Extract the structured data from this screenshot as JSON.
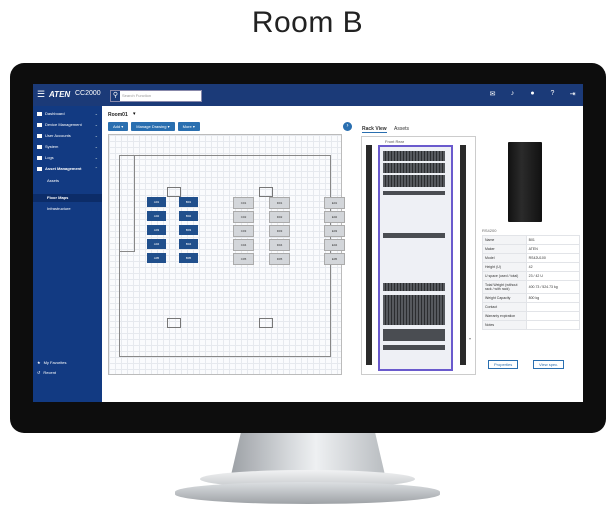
{
  "heading": "Room B",
  "topbar": {
    "brand": "ATEN",
    "product": "CC2000",
    "search_placeholder": "Search Function",
    "icons": [
      "chat-icon",
      "notification-icon",
      "user-icon",
      "help-icon",
      "logout-icon"
    ]
  },
  "sidebar": {
    "items": [
      {
        "label": "Dashboard"
      },
      {
        "label": "Device Management"
      },
      {
        "label": "User Accounts"
      },
      {
        "label": "System"
      },
      {
        "label": "Logs"
      },
      {
        "label": "Asset Management"
      }
    ],
    "subitems": [
      {
        "label": "Assets"
      },
      {
        "label": "Floor Maps"
      },
      {
        "label": "Infrastructure"
      }
    ],
    "bottom": [
      {
        "label": "My Favorites"
      },
      {
        "label": "Recent"
      }
    ]
  },
  "main": {
    "room": "Room01",
    "buttons": [
      {
        "label": "Add"
      },
      {
        "label": "Manage Drawing"
      },
      {
        "label": "More"
      }
    ],
    "tabs": [
      {
        "label": "Rack View"
      },
      {
        "label": "Assets"
      }
    ],
    "front_rear": "Front  Rear",
    "racks": [
      {
        "label": "A01"
      },
      {
        "label": "A02"
      },
      {
        "label": "A03"
      },
      {
        "label": "A04"
      },
      {
        "label": "A05"
      },
      {
        "label": "B01"
      },
      {
        "label": "B02"
      },
      {
        "label": "B03"
      },
      {
        "label": "B04"
      },
      {
        "label": "B05"
      },
      {
        "label": "C01"
      },
      {
        "label": "C02"
      },
      {
        "label": "C03"
      },
      {
        "label": "C04"
      },
      {
        "label": "C05"
      },
      {
        "label": "D01"
      },
      {
        "label": "D02"
      },
      {
        "label": "D03"
      },
      {
        "label": "D04"
      },
      {
        "label": "D05"
      },
      {
        "label": "E01"
      },
      {
        "label": "E02"
      },
      {
        "label": "E03"
      },
      {
        "label": "E04"
      },
      {
        "label": "E05"
      }
    ]
  },
  "panel": {
    "rack_name": "RS4200",
    "properties": [
      {
        "k": "Name",
        "v": "B01"
      },
      {
        "k": "Maker",
        "v": "ATEN"
      },
      {
        "k": "Model",
        "v": "RS42U100"
      },
      {
        "k": "Height (U)",
        "v": "42"
      },
      {
        "k": "U space (used / total)",
        "v": "23 / 42 U"
      },
      {
        "k": "Total Weight (without rack / with rack)",
        "v": "400.73 / 524.73 kg"
      },
      {
        "k": "Weight Capacity",
        "v": "800 kg"
      },
      {
        "k": "Contact",
        "v": ""
      },
      {
        "k": "Warranty expiration",
        "v": ""
      },
      {
        "k": "Notes",
        "v": ""
      }
    ],
    "properties_button": "Properties",
    "view_spec_button": "View spec."
  }
}
